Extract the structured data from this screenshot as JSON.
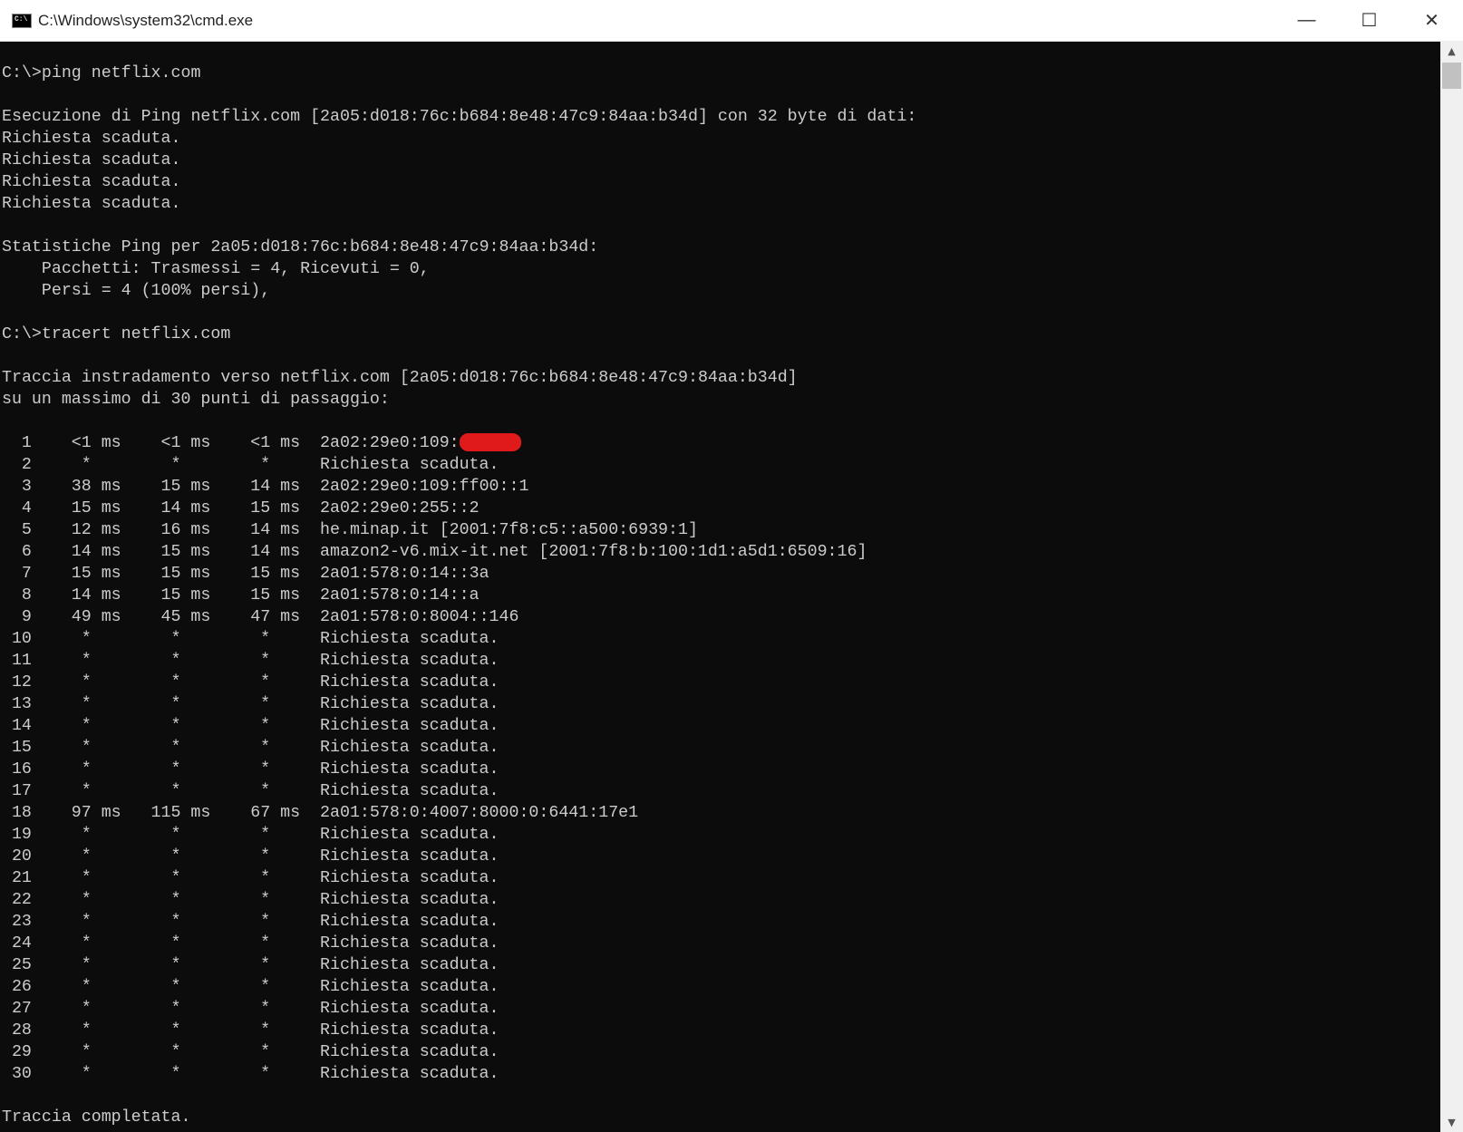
{
  "window": {
    "title": "C:\\Windows\\system32\\cmd.exe",
    "icon_text": "C:\\",
    "minimize": "—",
    "maximize": "☐",
    "close": "✕"
  },
  "ping": {
    "prompt": "C:\\>ping netflix.com",
    "header": "Esecuzione di Ping netflix.com [2a05:d018:76c:b684:8e48:47c9:84aa:b34d] con 32 byte di dati:",
    "replies": [
      "Richiesta scaduta.",
      "Richiesta scaduta.",
      "Richiesta scaduta.",
      "Richiesta scaduta."
    ],
    "stats_header": "Statistiche Ping per 2a05:d018:76c:b684:8e48:47c9:84aa:b34d:",
    "stats_packets": "    Pacchetti: Trasmessi = 4, Ricevuti = 0,",
    "stats_lost": "    Persi = 4 (100% persi),"
  },
  "tracert": {
    "prompt": "C:\\>tracert netflix.com",
    "header": "Traccia instradamento verso netflix.com [2a05:d018:76c:b684:8e48:47c9:84aa:b34d]",
    "header2": "su un massimo di 30 punti di passaggio:",
    "hops": [
      {
        "hop": "1",
        "t1": "<1 ms",
        "t2": "<1 ms",
        "t3": "<1 ms",
        "host": "2a02:29e0:109:",
        "redacted": true
      },
      {
        "hop": "2",
        "t1": "*",
        "t2": "*",
        "t3": "*",
        "host": "Richiesta scaduta."
      },
      {
        "hop": "3",
        "t1": "38 ms",
        "t2": "15 ms",
        "t3": "14 ms",
        "host": "2a02:29e0:109:ff00::1"
      },
      {
        "hop": "4",
        "t1": "15 ms",
        "t2": "14 ms",
        "t3": "15 ms",
        "host": "2a02:29e0:255::2"
      },
      {
        "hop": "5",
        "t1": "12 ms",
        "t2": "16 ms",
        "t3": "14 ms",
        "host": "he.minap.it [2001:7f8:c5::a500:6939:1]"
      },
      {
        "hop": "6",
        "t1": "14 ms",
        "t2": "15 ms",
        "t3": "14 ms",
        "host": "amazon2-v6.mix-it.net [2001:7f8:b:100:1d1:a5d1:6509:16]"
      },
      {
        "hop": "7",
        "t1": "15 ms",
        "t2": "15 ms",
        "t3": "15 ms",
        "host": "2a01:578:0:14::3a"
      },
      {
        "hop": "8",
        "t1": "14 ms",
        "t2": "15 ms",
        "t3": "15 ms",
        "host": "2a01:578:0:14::a"
      },
      {
        "hop": "9",
        "t1": "49 ms",
        "t2": "45 ms",
        "t3": "47 ms",
        "host": "2a01:578:0:8004::146"
      },
      {
        "hop": "10",
        "t1": "*",
        "t2": "*",
        "t3": "*",
        "host": "Richiesta scaduta."
      },
      {
        "hop": "11",
        "t1": "*",
        "t2": "*",
        "t3": "*",
        "host": "Richiesta scaduta."
      },
      {
        "hop": "12",
        "t1": "*",
        "t2": "*",
        "t3": "*",
        "host": "Richiesta scaduta."
      },
      {
        "hop": "13",
        "t1": "*",
        "t2": "*",
        "t3": "*",
        "host": "Richiesta scaduta."
      },
      {
        "hop": "14",
        "t1": "*",
        "t2": "*",
        "t3": "*",
        "host": "Richiesta scaduta."
      },
      {
        "hop": "15",
        "t1": "*",
        "t2": "*",
        "t3": "*",
        "host": "Richiesta scaduta."
      },
      {
        "hop": "16",
        "t1": "*",
        "t2": "*",
        "t3": "*",
        "host": "Richiesta scaduta."
      },
      {
        "hop": "17",
        "t1": "*",
        "t2": "*",
        "t3": "*",
        "host": "Richiesta scaduta."
      },
      {
        "hop": "18",
        "t1": "97 ms",
        "t2": "115 ms",
        "t3": "67 ms",
        "host": "2a01:578:0:4007:8000:0:6441:17e1"
      },
      {
        "hop": "19",
        "t1": "*",
        "t2": "*",
        "t3": "*",
        "host": "Richiesta scaduta."
      },
      {
        "hop": "20",
        "t1": "*",
        "t2": "*",
        "t3": "*",
        "host": "Richiesta scaduta."
      },
      {
        "hop": "21",
        "t1": "*",
        "t2": "*",
        "t3": "*",
        "host": "Richiesta scaduta."
      },
      {
        "hop": "22",
        "t1": "*",
        "t2": "*",
        "t3": "*",
        "host": "Richiesta scaduta."
      },
      {
        "hop": "23",
        "t1": "*",
        "t2": "*",
        "t3": "*",
        "host": "Richiesta scaduta."
      },
      {
        "hop": "24",
        "t1": "*",
        "t2": "*",
        "t3": "*",
        "host": "Richiesta scaduta."
      },
      {
        "hop": "25",
        "t1": "*",
        "t2": "*",
        "t3": "*",
        "host": "Richiesta scaduta."
      },
      {
        "hop": "26",
        "t1": "*",
        "t2": "*",
        "t3": "*",
        "host": "Richiesta scaduta."
      },
      {
        "hop": "27",
        "t1": "*",
        "t2": "*",
        "t3": "*",
        "host": "Richiesta scaduta."
      },
      {
        "hop": "28",
        "t1": "*",
        "t2": "*",
        "t3": "*",
        "host": "Richiesta scaduta."
      },
      {
        "hop": "29",
        "t1": "*",
        "t2": "*",
        "t3": "*",
        "host": "Richiesta scaduta."
      },
      {
        "hop": "30",
        "t1": "*",
        "t2": "*",
        "t3": "*",
        "host": "Richiesta scaduta."
      }
    ],
    "footer": "Traccia completata."
  },
  "scrollbar": {
    "up": "▲",
    "down": "▼"
  },
  "colors": {
    "console_bg": "#0c0c0c",
    "console_fg": "#cccccc",
    "redaction": "#e01a1a"
  }
}
